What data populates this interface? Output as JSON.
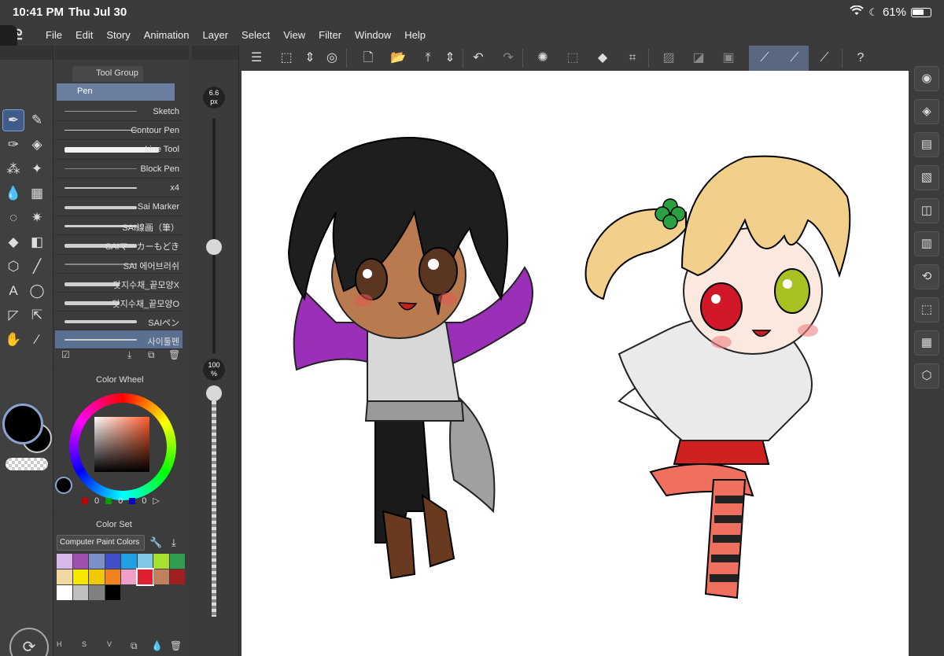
{
  "status_bar": {
    "time": "10:41 PM",
    "date": "Thu Jul 30",
    "battery": "61%"
  },
  "menu": {
    "items": [
      "File",
      "Edit",
      "Story",
      "Animation",
      "Layer",
      "Select",
      "View",
      "Filter",
      "Window",
      "Help"
    ]
  },
  "subtool_panel": {
    "tab_label": "Tool Group",
    "header": "Pen",
    "brushes": [
      "Sketch",
      "Contour Pen",
      "Line Tool",
      "Block Pen",
      "x4",
      "Sai Marker",
      "SAI線画（筆）",
      "SAIマーカーもどき",
      "SAI 에어브러쉬",
      "닷지수채_끝모양X",
      "닷지수채_끝모양O",
      "SAIペン",
      "사이툴펜"
    ],
    "selected_brush": "사이툴펜"
  },
  "brush_size": {
    "value": "6.6",
    "unit": "px"
  },
  "opacity": {
    "value": "100",
    "unit": "%"
  },
  "color_wheel": {
    "tab_label": "Color Wheel",
    "r": "0",
    "g": "0",
    "b": "0"
  },
  "color_set": {
    "tab_label": "Color Set",
    "selected_set": "Computer Paint Colors",
    "swatches": [
      "#d8b8e8",
      "#a050b0",
      "#7a90c8",
      "#4050c8",
      "#20a0e0",
      "#80c8e8",
      "#a8e030",
      "#30a050",
      "#f0d8a0",
      "#f8e800",
      "#f0c800",
      "#f08020",
      "#f0a0c8",
      "#e02030",
      "#c08060",
      "#a02020",
      "#ffffff",
      "#c0c0c0",
      "#808080",
      "#000000"
    ],
    "footer_labels": [
      "H",
      "S",
      "V"
    ]
  },
  "colors": {
    "accent": "#5a6780",
    "canvas": "#ffffff",
    "main_color": "#000000"
  },
  "icons": {
    "left_tools": [
      "pen-nib",
      "pencil",
      "pen",
      "eraser",
      "airbrush",
      "decoration",
      "fill-drop",
      "grid-ruler",
      "lasso",
      "magic-wand",
      "fill-bucket",
      "gradient",
      "3d-cube",
      "line",
      "text",
      "balloon",
      "vector-correct",
      "move-arrow",
      "hand",
      "eyedropper"
    ],
    "toolbar": [
      "hamburger-menu",
      "edit-transform",
      "updown-arrows",
      "target",
      "new-page",
      "open-folder",
      "save",
      "updown-arrows",
      "undo",
      "redo",
      "loading",
      "dots-square",
      "fill",
      "crop-transform",
      "clear-selection",
      "invert",
      "select-all",
      "pen-stroke",
      "pen-stroke-2",
      "pen-stroke-3",
      "help"
    ],
    "right_dock": [
      "navigator",
      "layers",
      "layer-property",
      "material",
      "sub-view",
      "tool-property",
      "history",
      "animation",
      "timeline",
      "3d-material"
    ]
  }
}
